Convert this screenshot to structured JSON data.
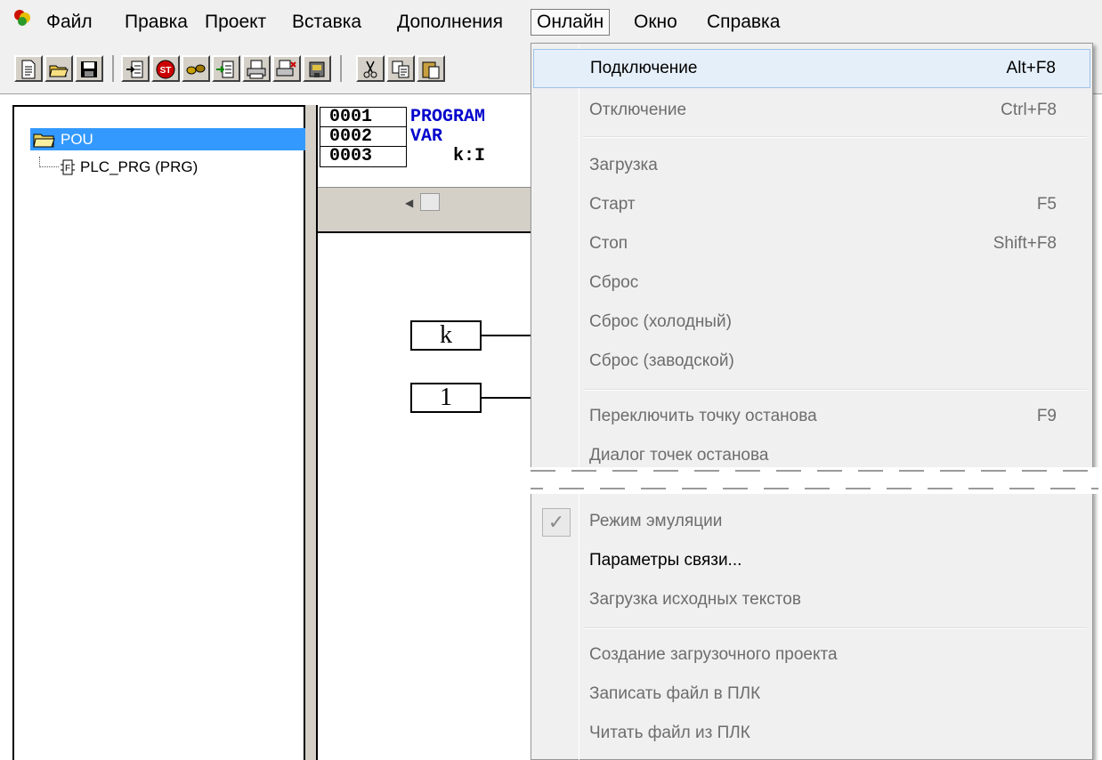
{
  "menubar": {
    "items": [
      "Файл",
      "Правка",
      "Проект",
      "Вставка",
      "Дополнения",
      "Онлайн",
      "Окно",
      "Справка"
    ],
    "active_index": 5
  },
  "tree": {
    "root": "POU",
    "child": "PLC_PRG (PRG)"
  },
  "editor": {
    "lines": [
      {
        "num": "0001",
        "text": "PROGRAM"
      },
      {
        "num": "0002",
        "text": "VAR"
      },
      {
        "num": "0003",
        "text": "    k:I"
      }
    ],
    "variables": [
      "k",
      "1"
    ]
  },
  "online_menu": {
    "items": [
      {
        "label": "Подключение",
        "shortcut": "Alt+F8",
        "enabled": true,
        "highlighted": true
      },
      {
        "label": "Отключение",
        "shortcut": "Ctrl+F8",
        "enabled": false
      },
      {
        "label": "Загрузка",
        "shortcut": "",
        "enabled": false
      },
      {
        "label": "Старт",
        "shortcut": "F5",
        "enabled": false
      },
      {
        "label": "Стоп",
        "shortcut": "Shift+F8",
        "enabled": false
      },
      {
        "label": "Сброс",
        "shortcut": "",
        "enabled": false
      },
      {
        "label": "Сброс (холодный)",
        "shortcut": "",
        "enabled": false
      },
      {
        "label": "Сброс (заводской)",
        "shortcut": "",
        "enabled": false
      },
      {
        "label": "Переключить точку останова",
        "shortcut": "F9",
        "enabled": false
      },
      {
        "label": "Диалог точек останова",
        "shortcut": "",
        "enabled": false
      },
      {
        "label": "Режим эмуляции",
        "shortcut": "",
        "enabled": false,
        "checked": true
      },
      {
        "label": "Параметры связи...",
        "shortcut": "",
        "enabled": true
      },
      {
        "label": "Загрузка исходных текстов",
        "shortcut": "",
        "enabled": false
      },
      {
        "label": "Создание загрузочного проекта",
        "shortcut": "",
        "enabled": false
      },
      {
        "label": "Записать файл в ПЛК",
        "shortcut": "",
        "enabled": false
      },
      {
        "label": "Читать файл из ПЛК",
        "shortcut": "",
        "enabled": false
      }
    ]
  },
  "toolbar": {
    "icons": [
      "new-file-icon",
      "open-folder-icon",
      "save-icon",
      "import-icon",
      "stop-st-icon",
      "glasses-icon",
      "export-icon",
      "print-icon",
      "print-setup-icon",
      "build-icon",
      "cut-icon",
      "copy-icon",
      "paste-icon"
    ]
  },
  "colors": {
    "selection": "#3399ff",
    "keyword": "#0000cc",
    "menu_bg": "#f0f0f0",
    "menu_highlight": "#e5eff9"
  }
}
